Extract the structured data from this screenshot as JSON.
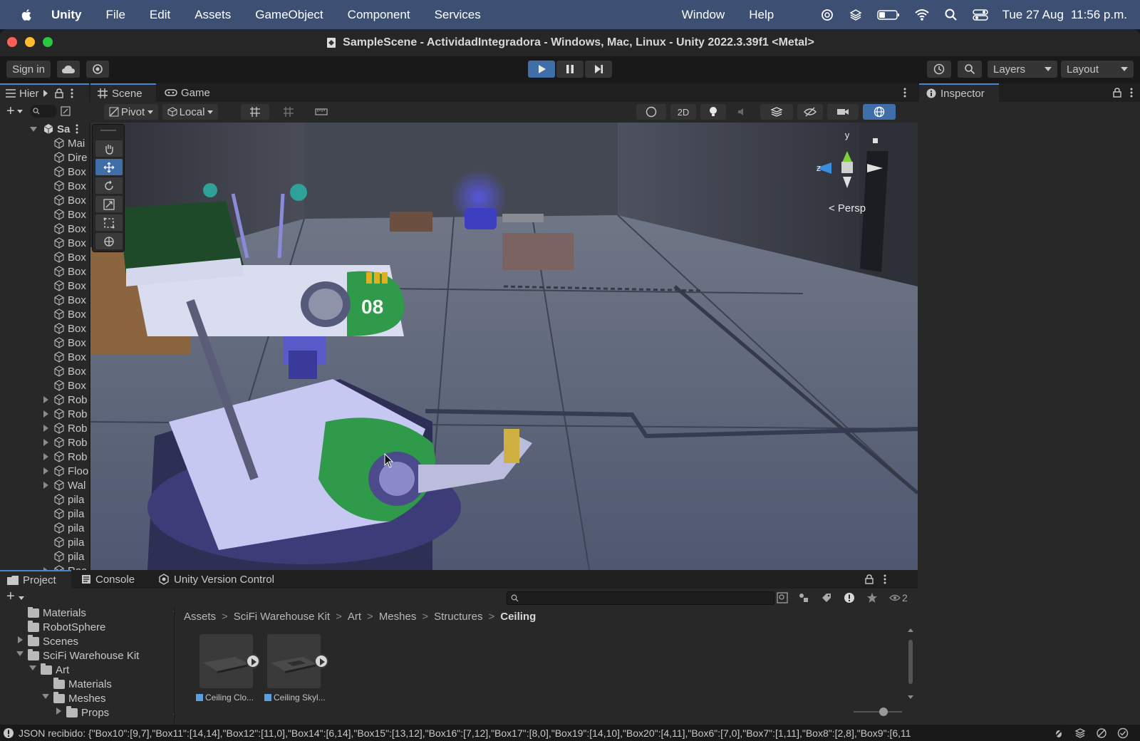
{
  "menubar": {
    "app": "Unity",
    "items": [
      "File",
      "Edit",
      "Assets",
      "GameObject",
      "Component",
      "Services",
      "Window",
      "Help"
    ],
    "date": "Tue 27 Aug",
    "time": "11:56 p.m."
  },
  "window": {
    "title": "SampleScene - ActividadIntegradora - Windows, Mac, Linux - Unity 2022.3.39f1 <Metal>"
  },
  "toolbar": {
    "sign_in": "Sign in",
    "layers": "Layers",
    "layout": "Layout"
  },
  "hierarchy": {
    "tab": "Hier",
    "scene_root": "Sa",
    "items": [
      "Mai",
      "Dire",
      "Box",
      "Box",
      "Box",
      "Box",
      "Box",
      "Box",
      "Box",
      "Box",
      "Box",
      "Box",
      "Box",
      "Box",
      "Box",
      "Box",
      "Box",
      "Box",
      "Rob",
      "Rob",
      "Rob",
      "Rob",
      "Rob",
      "Floo",
      "Wal",
      "pila",
      "pila",
      "pila",
      "pila",
      "pila",
      "Rac"
    ]
  },
  "scene": {
    "tabs": [
      "Scene",
      "Game"
    ],
    "pivot": "Pivot",
    "local": "Local",
    "mode_2d": "2D",
    "gizmo_y": "y",
    "gizmo_z": "z",
    "persp": "< Persp"
  },
  "inspector": {
    "tab": "Inspector"
  },
  "bottom": {
    "tabs": [
      "Project",
      "Console",
      "Unity Version Control"
    ],
    "hidden_count": "2",
    "tree": [
      "Materials",
      "RobotSphere",
      "Scenes",
      "SciFi Warehouse Kit",
      "Art",
      "Materials",
      "Meshes",
      "Props"
    ],
    "breadcrumb": [
      "Assets",
      "SciFi Warehouse Kit",
      "Art",
      "Meshes",
      "Structures",
      "Ceiling"
    ],
    "assets": [
      "Ceiling Clo...",
      "Ceiling Skyl..."
    ]
  },
  "status": {
    "message": "JSON recibido: {\"Box10\":[9,7],\"Box11\":[14,14],\"Box12\":[11,0],\"Box14\":[6,14],\"Box15\":[13,12],\"Box16\":[7,12],\"Box17\":[8,0],\"Box19\":[14,10],\"Box20\":[4,11],\"Box6\":[7,0],\"Box7\":[1,11],\"Box8\":[2,8],\"Box9\":[6,11"
  },
  "colors": {
    "menubar": "#3d4f73",
    "accent": "#4a84d0",
    "play_button": "#3f6ea8"
  }
}
